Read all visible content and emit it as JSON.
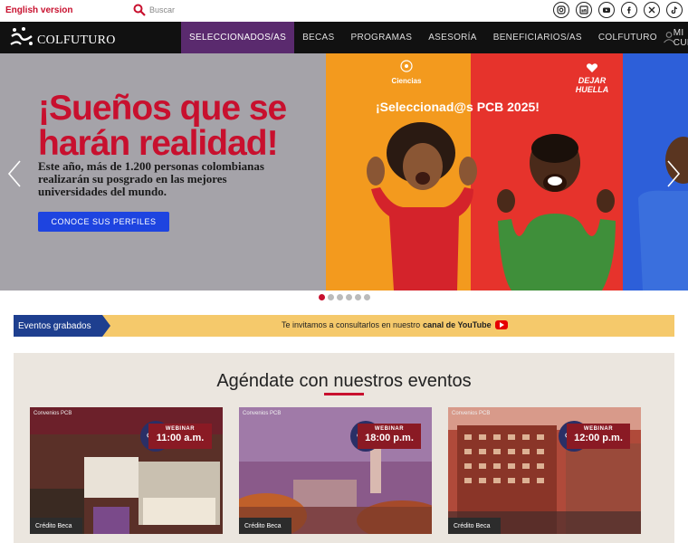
{
  "topbar": {
    "english_link": "English version",
    "search_placeholder": "Buscar",
    "socials": [
      "instagram",
      "linkedin",
      "youtube",
      "facebook",
      "x",
      "tiktok"
    ]
  },
  "nav": {
    "logo_text": "COLFUTURO",
    "items": [
      {
        "label": "SELECCIONADOS/AS",
        "active": true
      },
      {
        "label": "BECAS",
        "active": false
      },
      {
        "label": "PROGRAMAS",
        "active": false
      },
      {
        "label": "ASESORÍA",
        "active": false
      },
      {
        "label": "BENEFICIARIOS/AS",
        "active": false
      },
      {
        "label": "COLFUTURO",
        "active": false
      },
      {
        "label": "MI CUENTA",
        "active": false
      }
    ]
  },
  "hero": {
    "headline_1": "¡Sueños que se",
    "headline_2": "harán realidad!",
    "body": "Este año, más de 1.200 personas colombianas realizarán su posgrado en las mejores universidades del mundo.",
    "cta": "CONOCE SUS PERFILES",
    "selected_text": "¡Seleccionad@s PCB 2025!",
    "ciencias_label": "Ciencias",
    "dejar_line1": "DEJAR",
    "dejar_line2": "HUELLA",
    "dots": 6,
    "active_dot": 0,
    "colors": {
      "headline": "#c8102e",
      "cta": "#1e44e0"
    }
  },
  "events_bar": {
    "tag": "Eventos grabados",
    "message_prefix": "Te invitamos a consultarlos en nuestro",
    "message_link": "canal de YouTube"
  },
  "agenda": {
    "title": "Agéndate con nuestros eventos",
    "cards": [
      {
        "top_label": "Convenios PCB",
        "type": "WEBINAR",
        "time": "11:00 a.m.",
        "tag": "Crédito Beca"
      },
      {
        "top_label": "Convenios PCB",
        "type": "WEBINAR",
        "time": "18:00 p.m.",
        "tag": "Crédito Beca"
      },
      {
        "top_label": "Convenios PCB",
        "type": "WEBINAR",
        "time": "12:00 p.m.",
        "tag": "Crédito Beca"
      }
    ]
  }
}
